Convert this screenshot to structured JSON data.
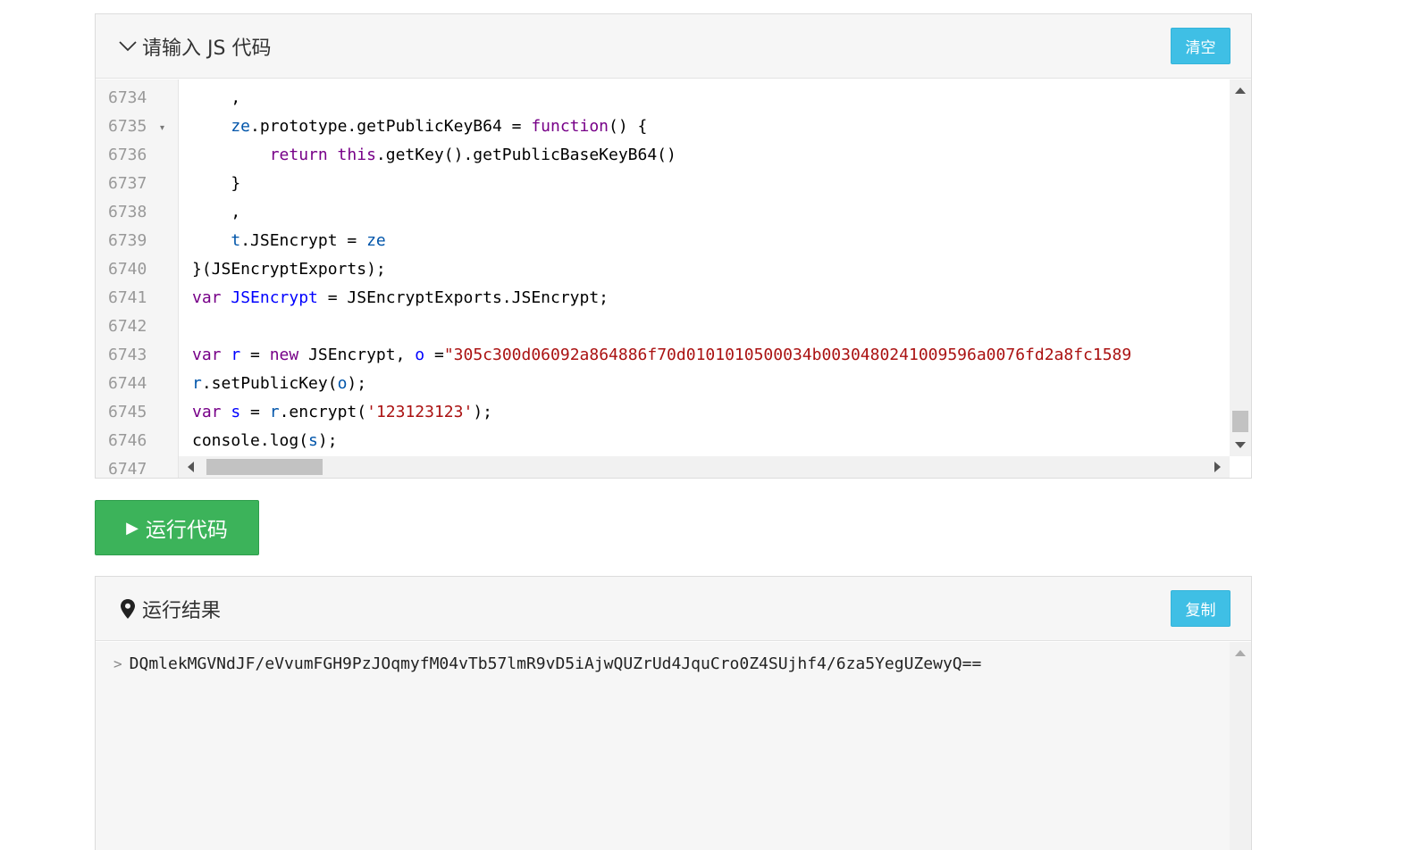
{
  "editor": {
    "title": "请输入 JS 代码",
    "clear_label": "清空",
    "line_numbers": [
      "6734",
      "6735",
      "6736",
      "6737",
      "6738",
      "6739",
      "6740",
      "6741",
      "6742",
      "6743",
      "6744",
      "6745",
      "6746",
      "6747"
    ],
    "fold_marker": "▾"
  },
  "code_lines": [
    [
      [
        "p",
        "    ,"
      ]
    ],
    [
      [
        "vr",
        "    ze"
      ],
      [
        "p",
        ".prototype.getPublicKeyB64 = "
      ],
      [
        "kw",
        "function"
      ],
      [
        "p",
        "() {"
      ]
    ],
    [
      [
        "kw",
        "        return this"
      ],
      [
        "p",
        ".getKey().getPublicBaseKeyB64()"
      ]
    ],
    [
      [
        "p",
        "    }"
      ]
    ],
    [
      [
        "p",
        "    ,"
      ]
    ],
    [
      [
        "vr",
        "    t"
      ],
      [
        "p",
        ".JSEncrypt = "
      ],
      [
        "vr",
        "ze"
      ]
    ],
    [
      [
        "p",
        "}(JSEncryptExports);"
      ]
    ],
    [
      [
        "kw",
        "var "
      ],
      [
        "vd",
        "JSEncrypt"
      ],
      [
        "p",
        " = JSEncryptExports.JSEncrypt;"
      ]
    ],
    [
      [
        "p",
        ""
      ]
    ],
    [
      [
        "kw",
        "var "
      ],
      [
        "vd",
        "r"
      ],
      [
        "p",
        " = "
      ],
      [
        "kw",
        "new"
      ],
      [
        "p",
        " JSEncrypt, "
      ],
      [
        "vd",
        "o"
      ],
      [
        "p",
        " ="
      ],
      [
        "st",
        "\"305c300d06092a864886f70d0101010500034b0030480241009596a0076fd2a8fc1589"
      ]
    ],
    [
      [
        "vr",
        "r"
      ],
      [
        "p",
        ".setPublicKey("
      ],
      [
        "vr",
        "o"
      ],
      [
        "p",
        ");"
      ]
    ],
    [
      [
        "kw",
        "var "
      ],
      [
        "vd",
        "s"
      ],
      [
        "p",
        " = "
      ],
      [
        "vr",
        "r"
      ],
      [
        "p",
        ".encrypt("
      ],
      [
        "st",
        "'123123123'"
      ],
      [
        "p",
        ");"
      ]
    ],
    [
      [
        "p",
        "console.log("
      ],
      [
        "vr",
        "s"
      ],
      [
        "p",
        ");"
      ]
    ]
  ],
  "run_button": {
    "label": "运行代码"
  },
  "result": {
    "title": "运行结果",
    "copy_label": "复制",
    "output": "DQmlekMGVNdJF/eVvumFGH9PzJOqmyfM04vTb57lmR9vD5iAjwQUZrUd4JquCro0Z4SUjhf4/6za5YegUZewyQ=="
  }
}
